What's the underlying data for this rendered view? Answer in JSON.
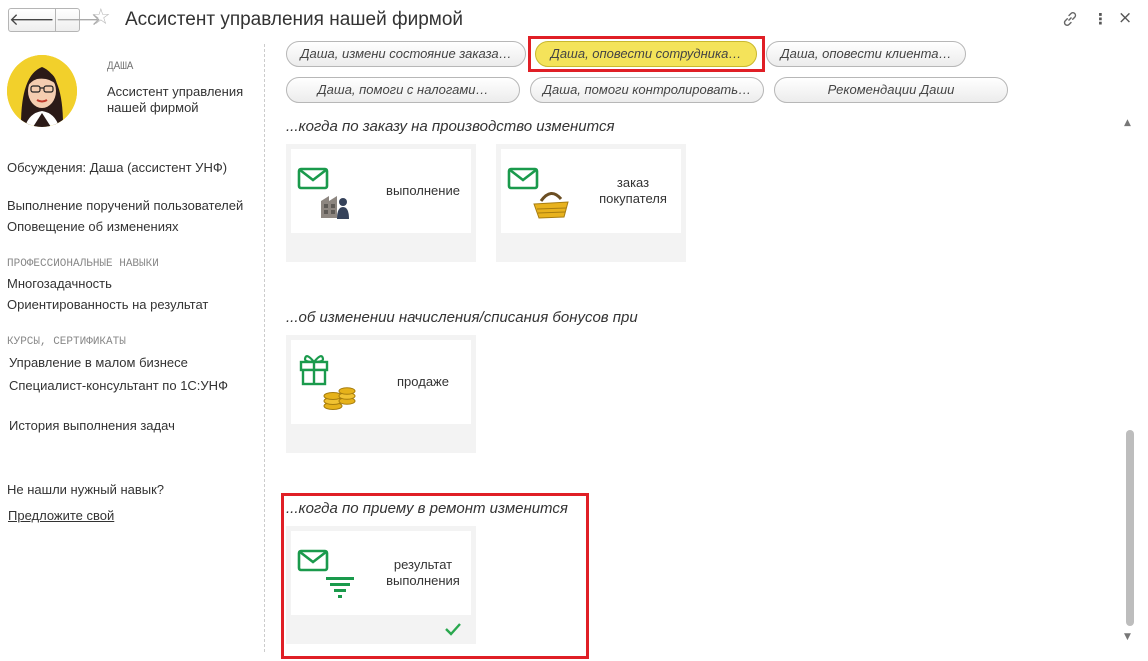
{
  "window": {
    "title": "Ассистент управления нашей фирмой",
    "back_glyph": "🡐",
    "forward_glyph": "🡒",
    "star_glyph": "☆",
    "more_glyph": "⋮",
    "close_glyph": "×"
  },
  "agent": {
    "name_label": "ДАША",
    "description": "Ассистент управления нашей фирмой"
  },
  "sidebar": {
    "discussions": "Обсуждения: Даша (ассистент УНФ)",
    "tasks": [
      "Выполнение поручений пользователей",
      "Оповещение об изменениях"
    ],
    "skills_header": "ПРОФЕССИОНАЛЬНЫЕ НАВЫКИ",
    "skills": [
      "Многозадачность",
      "Ориентированность на результат"
    ],
    "courses_header": "КУРСЫ, СЕРТИФИКАТЫ",
    "courses": [
      "Управление в малом бизнесе",
      "Специалист-консультант по 1С:УНФ"
    ],
    "history": "История выполнения задач",
    "not_found": "Не нашли нужный навык?",
    "suggest_link": "Предложите свой"
  },
  "chips": [
    {
      "label": "Даша, измени состояние заказа…",
      "active": false
    },
    {
      "label": "Даша, оповести сотрудника…",
      "active": true
    },
    {
      "label": "Даша, оповести клиента…",
      "active": false
    },
    {
      "label": "Даша, помоги с налогами…",
      "active": false
    },
    {
      "label": "Даша, помоги контролировать…",
      "active": false
    },
    {
      "label": "Рекомендации Даши",
      "active": false
    }
  ],
  "sections": [
    {
      "title": "...когда по заказу на производство изменится",
      "cards": [
        {
          "label": "выполнение",
          "icon": "mail-factory-icon"
        },
        {
          "label": "заказ покупателя",
          "icon": "mail-basket-icon"
        }
      ]
    },
    {
      "title": "...об изменении начисления/списания бонусов при",
      "cards": [
        {
          "label": "продаже",
          "icon": "gift-coins-icon"
        }
      ]
    },
    {
      "title": "...когда по приему в ремонт изменится",
      "cards": [
        {
          "label": "результат выполнения",
          "icon": "mail-filter-icon",
          "selected": true
        }
      ]
    }
  ],
  "colors": {
    "accent_yellow": "#f4e35a",
    "highlight_red": "#e01f26",
    "icon_green": "#1a9a4c",
    "check_green": "#2aa84f"
  }
}
